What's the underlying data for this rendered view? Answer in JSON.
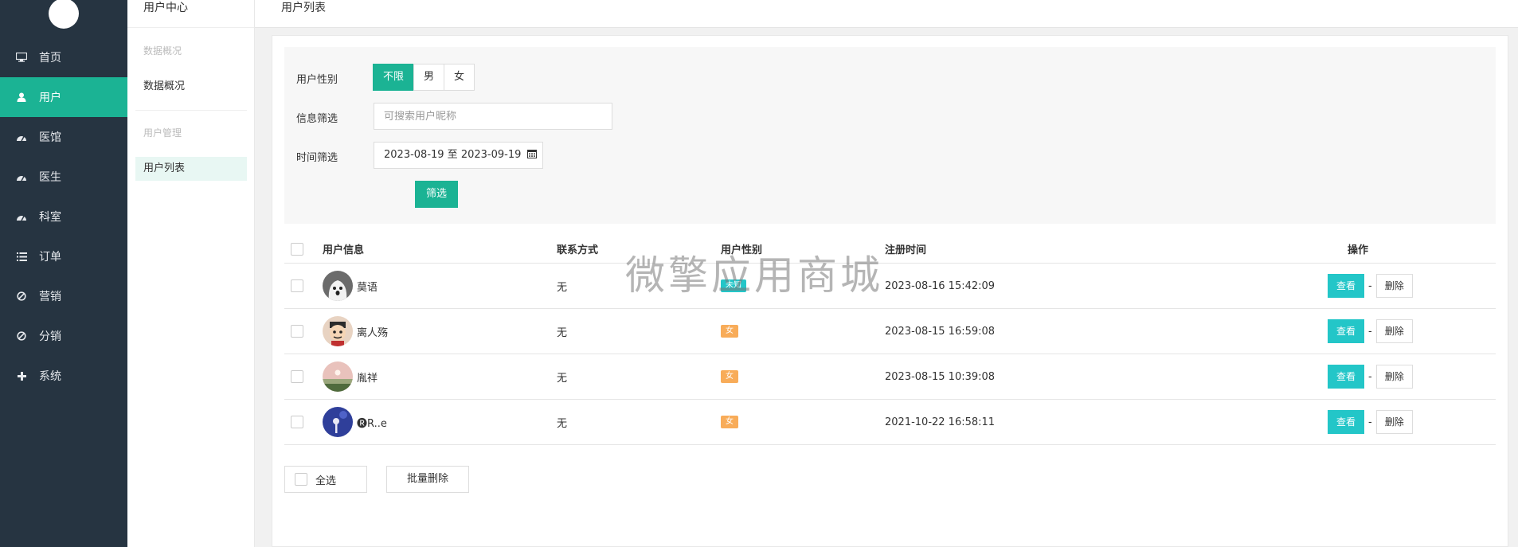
{
  "sidebar": {
    "items": [
      {
        "label": "首页",
        "icon": "monitor-icon"
      },
      {
        "label": "用户",
        "icon": "user-icon",
        "active": true
      },
      {
        "label": "医馆",
        "icon": "dashboard-icon"
      },
      {
        "label": "医生",
        "icon": "dashboard-icon"
      },
      {
        "label": "科室",
        "icon": "dashboard-icon"
      },
      {
        "label": "订单",
        "icon": "list-icon"
      },
      {
        "label": "营销",
        "icon": "ban-icon"
      },
      {
        "label": "分销",
        "icon": "ban-icon"
      },
      {
        "label": "系统",
        "icon": "plus-icon"
      }
    ]
  },
  "subnav": {
    "title": "用户中心",
    "group1": "数据概况",
    "link1": "数据概况",
    "group2": "用户管理",
    "link2": "用户列表"
  },
  "header": {
    "breadcrumb": "用户列表"
  },
  "filter": {
    "gender_label": "用户性别",
    "gender_options": [
      "不限",
      "男",
      "女"
    ],
    "gender_selected": "不限",
    "info_label": "信息筛选",
    "search_placeholder": "可搜索用户昵称",
    "time_label": "时间筛选",
    "date_range": "2023-08-19 至 2023-09-19",
    "submit": "筛选"
  },
  "table": {
    "headers": {
      "user": "用户信息",
      "contact": "联系方式",
      "gender": "用户性别",
      "reg": "注册时间",
      "ops": "操作"
    },
    "rows": [
      {
        "name": "莫语",
        "contact": "无",
        "gender": "未知",
        "gender_type": "unknown",
        "time": "2023-08-16 15:42:09"
      },
      {
        "name": "离人殇",
        "contact": "无",
        "gender": "女",
        "gender_type": "female",
        "time": "2023-08-15 16:59:08"
      },
      {
        "name": "胤祥",
        "contact": "无",
        "gender": "女",
        "gender_type": "female",
        "time": "2023-08-15 10:39:08"
      },
      {
        "name": "🅡R..e",
        "contact": "无",
        "gender": "女",
        "gender_type": "female",
        "time": "2021-10-22 16:58:11"
      }
    ],
    "view_label": "查看",
    "sep": "-",
    "delete_label": "删除"
  },
  "footer": {
    "select_all": "全选",
    "batch_delete": "批量删除"
  },
  "watermark": "微擎应用商城",
  "colors": {
    "sidebar_bg": "#263441",
    "primary": "#1bb394",
    "info": "#23c6c8",
    "warning": "#f8ac59"
  }
}
